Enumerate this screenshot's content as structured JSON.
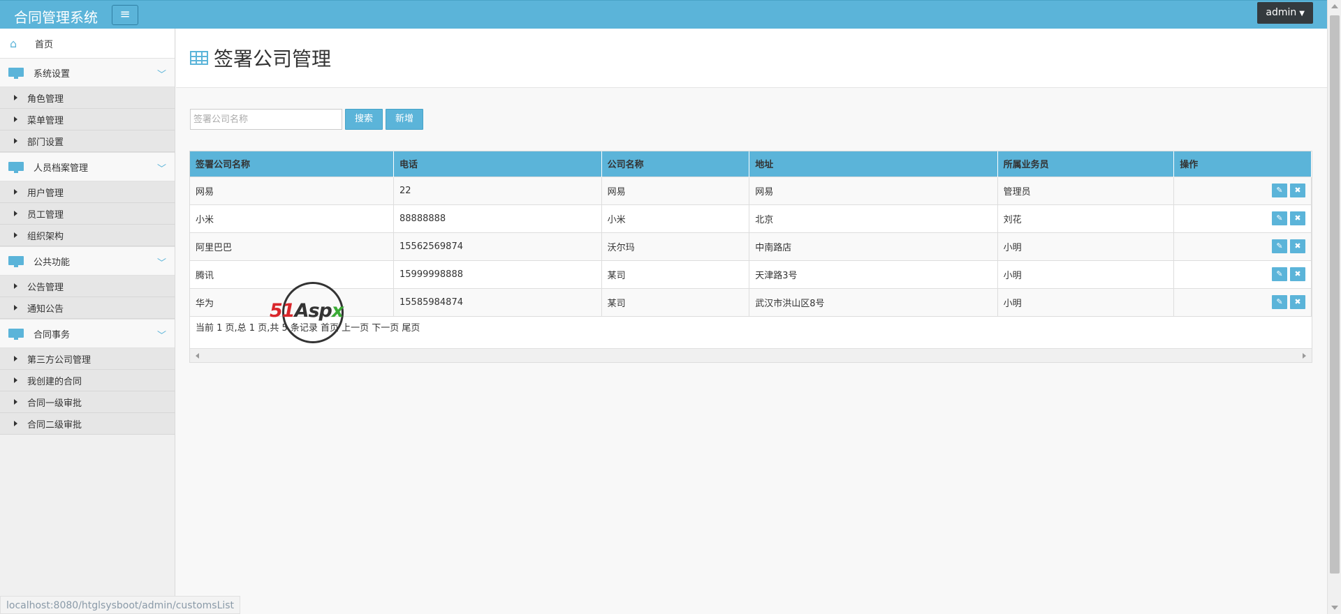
{
  "header": {
    "brand": "合同管理系统",
    "menu_toggle_glyph": "≡",
    "user": "admin"
  },
  "sidebar": {
    "home": "首页",
    "groups": [
      {
        "label": "系统设置",
        "items": [
          "角色管理",
          "菜单管理",
          "部门设置"
        ]
      },
      {
        "label": "人员档案管理",
        "items": [
          "用户管理",
          "员工管理",
          "组织架构"
        ]
      },
      {
        "label": "公共功能",
        "items": [
          "公告管理",
          "通知公告"
        ]
      },
      {
        "label": "合同事务",
        "items": [
          "第三方公司管理",
          "我创建的合同",
          "合同一级审批",
          "合同二级审批"
        ]
      }
    ]
  },
  "page": {
    "title": "签署公司管理"
  },
  "toolbar": {
    "search_placeholder": "签署公司名称",
    "search_label": "搜索",
    "add_label": "新增"
  },
  "table": {
    "columns": [
      "签署公司名称",
      "电话",
      "公司名称",
      "地址",
      "所属业务员",
      "操作"
    ],
    "rows": [
      [
        "网易",
        "22",
        "网易",
        "网易",
        "管理员"
      ],
      [
        "小米",
        "88888888",
        "小米",
        "北京",
        "刘花"
      ],
      [
        "阿里巴巴",
        "15562569874",
        "沃尔玛",
        "中南路店",
        "小明"
      ],
      [
        "腾讯",
        "15999998888",
        "某司",
        "天津路3号",
        "小明"
      ],
      [
        "华为",
        "15585984874",
        "某司",
        "武汉市洪山区8号",
        "小明"
      ]
    ],
    "edit_icon": "edit-icon",
    "delete_icon": "close-icon"
  },
  "pager": {
    "text": "当前 1 页,总 1 页,共 5 条记录 首页 上一页 下一页 尾页"
  },
  "status_bar": {
    "url": "localhost:8080/htglsysboot/admin/customsList"
  },
  "watermark": {
    "part1": "51",
    "part2": "Asp",
    "part3": "x"
  },
  "colors": {
    "accent": "#5bb4d9",
    "user_button": "#343a3e"
  }
}
